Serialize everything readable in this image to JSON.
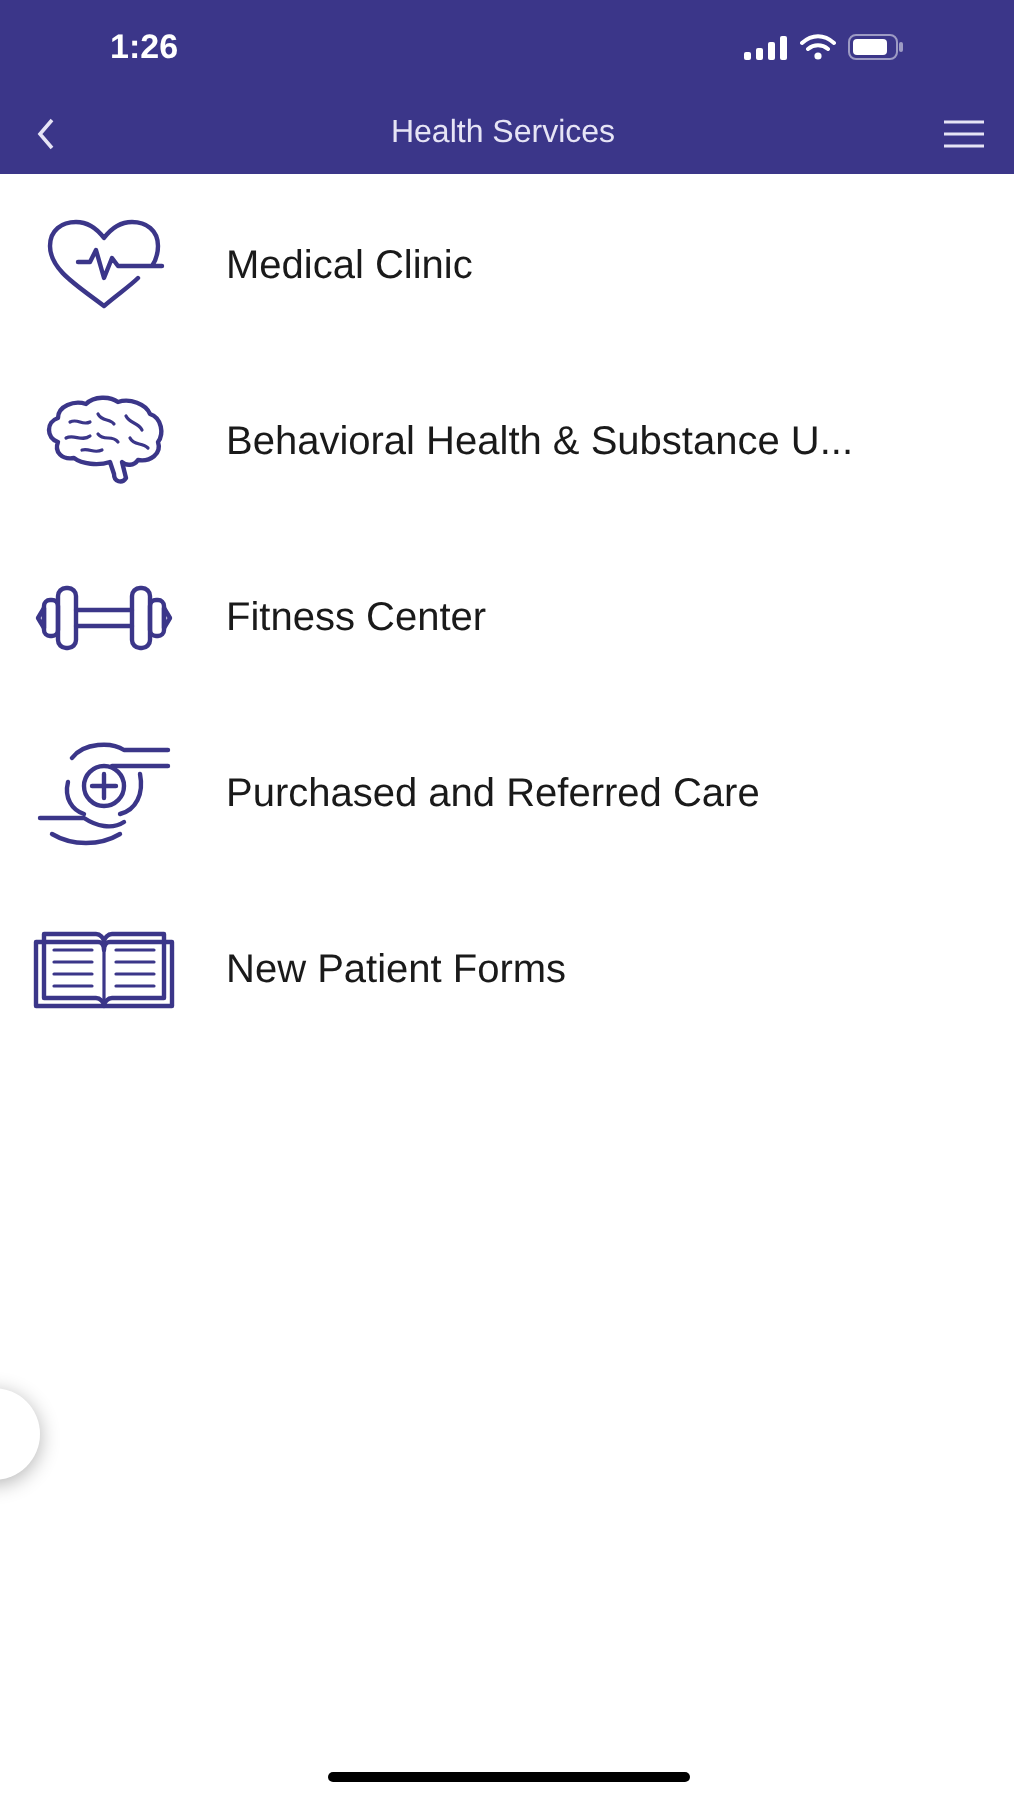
{
  "status_bar": {
    "time": "1:26"
  },
  "nav_bar": {
    "title": "Health Services"
  },
  "services": [
    {
      "kind": "heart",
      "label": "Medical Clinic"
    },
    {
      "kind": "brain",
      "label": "Behavioral Health & Substance U..."
    },
    {
      "kind": "dumbbell",
      "label": "Fitness Center"
    },
    {
      "kind": "care",
      "label": "Purchased and Referred Care"
    },
    {
      "kind": "book",
      "label": "New Patient Forms"
    }
  ]
}
